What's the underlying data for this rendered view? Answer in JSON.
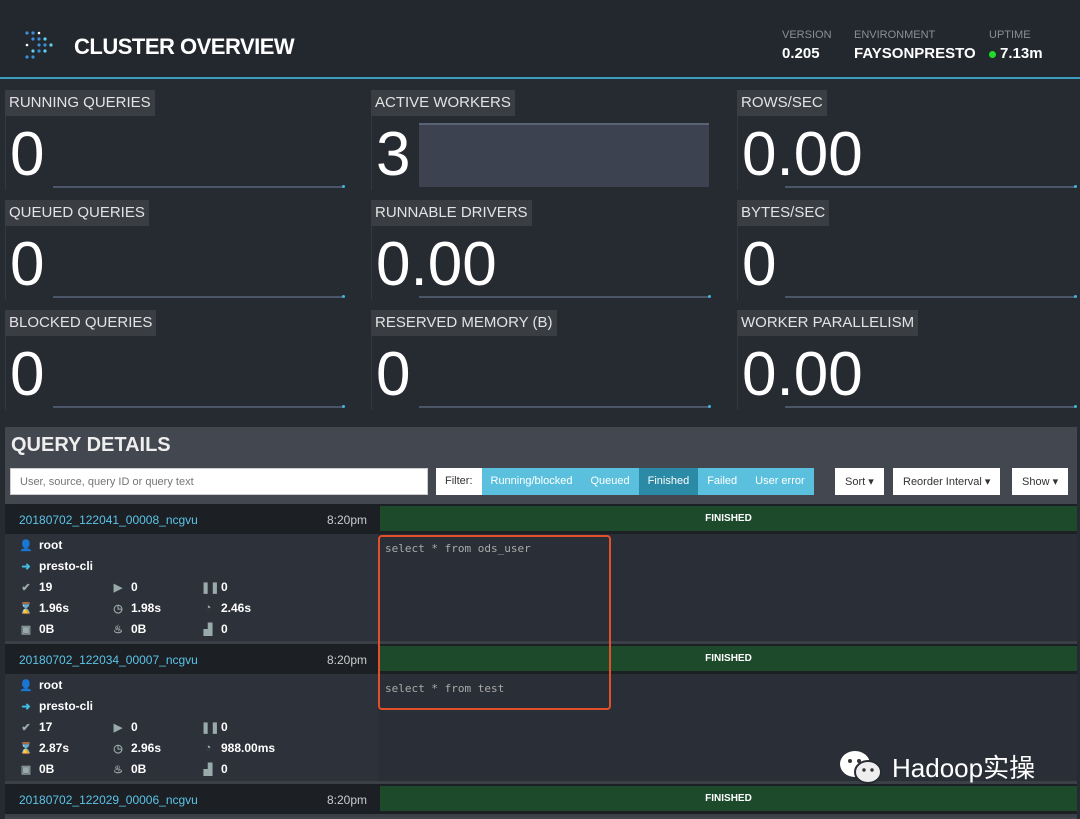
{
  "header": {
    "title": "CLUSTER OVERVIEW",
    "version_label": "VERSION",
    "version": "0.205",
    "environment_label": "ENVIRONMENT",
    "environment": "FAYSONPRESTO",
    "uptime_label": "UPTIME",
    "uptime": "7.13m",
    "uptime_status_color": "#1fdc2b"
  },
  "stats": [
    {
      "label": "RUNNING QUERIES",
      "value": "0"
    },
    {
      "label": "ACTIVE WORKERS",
      "value": "3"
    },
    {
      "label": "ROWS/SEC",
      "value": "0.00"
    },
    {
      "label": "QUEUED QUERIES",
      "value": "0"
    },
    {
      "label": "RUNNABLE DRIVERS",
      "value": "0.00"
    },
    {
      "label": "BYTES/SEC",
      "value": "0"
    },
    {
      "label": "BLOCKED QUERIES",
      "value": "0"
    },
    {
      "label": "RESERVED MEMORY (B)",
      "value": "0"
    },
    {
      "label": "WORKER PARALLELISM",
      "value": "0.00"
    }
  ],
  "query_details": {
    "title": "QUERY DETAILS",
    "search_placeholder": "User, source, query ID or query text",
    "filter_label": "Filter:",
    "filters": [
      {
        "label": "Running/blocked",
        "active": false
      },
      {
        "label": "Queued",
        "active": false
      },
      {
        "label": "Finished",
        "active": true
      },
      {
        "label": "Failed",
        "active": false
      },
      {
        "label": "User error",
        "active": false
      }
    ],
    "sort_label": "Sort ▾",
    "reorder_label": "Reorder Interval ▾",
    "show_label": "Show ▾",
    "queries": [
      {
        "id": "20180702_122041_00008_ncgvu",
        "time": "8:20pm",
        "state": "FINISHED",
        "user": "root",
        "source": "presto-cli",
        "completed_splits": "19",
        "running_splits": "0",
        "queued_splits": "0",
        "wall_time": "1.96s",
        "elapsed_time": "1.98s",
        "cpu_time": "2.46s",
        "memory": "0B",
        "peak_memory": "0B",
        "parallelism": "0",
        "sql": "select * from ods_user"
      },
      {
        "id": "20180702_122034_00007_ncgvu",
        "time": "8:20pm",
        "state": "FINISHED",
        "user": "root",
        "source": "presto-cli",
        "completed_splits": "17",
        "running_splits": "0",
        "queued_splits": "0",
        "wall_time": "2.87s",
        "elapsed_time": "2.96s",
        "cpu_time": "988.00ms",
        "memory": "0B",
        "peak_memory": "0B",
        "parallelism": "0",
        "sql": "select * from test"
      },
      {
        "id": "20180702_122029_00006_ncgvu",
        "time": "8:20pm",
        "state": "FINISHED"
      }
    ]
  },
  "watermark": "Hadoop实操"
}
